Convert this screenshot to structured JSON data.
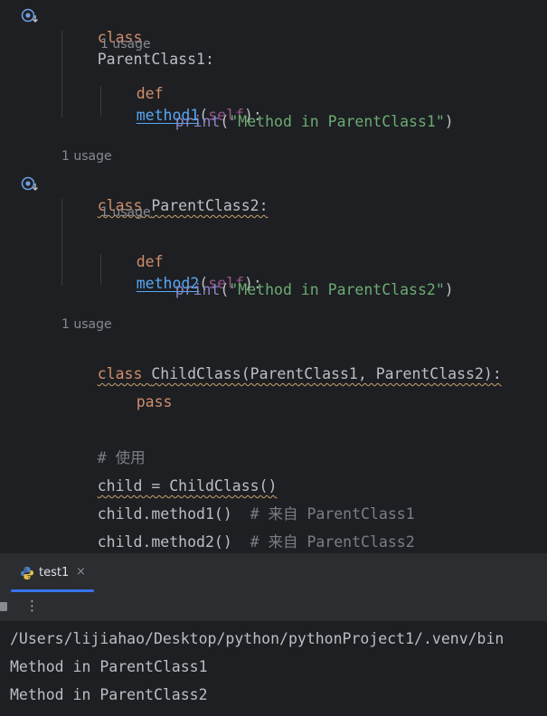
{
  "editor": {
    "hints": {
      "usage": "1 usage"
    },
    "code": {
      "l1_kw": "class",
      "l1_name": "ParentClass1:",
      "l2_kw": "def",
      "l2_fn": "method1",
      "l2_open": "(",
      "l2_self": "self",
      "l2_close": "):",
      "l3_fn": "print",
      "l3_open": "(",
      "l3_str": "\"Method in ParentClass1\"",
      "l3_close": ")",
      "l4_kw": "class",
      "l4_name": "ParentClass2:",
      "l5_kw": "def",
      "l5_fn": "method2",
      "l5_open": "(",
      "l5_self": "self",
      "l5_close": "):",
      "l6_fn": "print",
      "l6_open": "(",
      "l6_str": "\"Method in ParentClass2\"",
      "l6_close": ")",
      "l7_kw": "class",
      "l7_rest": "ChildClass(ParentClass1, ParentClass2):",
      "l8_kw": "pass",
      "l9_comment": "# 使用",
      "l10": "child = ChildClass()",
      "l11_code": "child.method1()",
      "l11_comment": "# 来自 ParentClass1",
      "l12_code": "child.method2()",
      "l12_comment": "# 来自 ParentClass2"
    },
    "gutter_icons": [
      "override-marker-icon",
      "override-marker-icon"
    ]
  },
  "run_panel": {
    "tab_label": "test1",
    "tab_close": "×",
    "toolbar_more": "⋮",
    "output": [
      "/Users/lijiahao/Desktop/python/pythonProject1/.venv/bin",
      "Method in ParentClass1",
      "Method in ParentClass2"
    ]
  },
  "colors": {
    "keyword": "#cf8e6d",
    "function": "#56a8f5",
    "string": "#6aab73",
    "self": "#94558d",
    "builtin": "#8888c6",
    "comment": "#7a7e85",
    "accent": "#3574f0"
  }
}
